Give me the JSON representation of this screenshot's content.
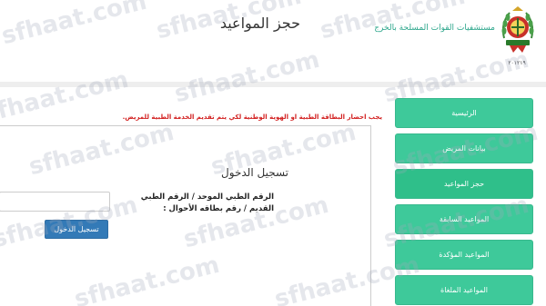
{
  "header": {
    "hospital_name": "مستشفيات القوات المسلحة بالخرج",
    "page_title": "حجز المواعيد",
    "logo_date": "٢٠١٢١٩"
  },
  "warning": "يجب احضار البطاقة الطبية او الهوية الوطنية لكي يتم تقديم الخدمة الطبية للمريض.",
  "sidebar": {
    "items": [
      {
        "label": "الرئيسية"
      },
      {
        "label": "بيانات المريض"
      },
      {
        "label": "حجز المواعيد"
      },
      {
        "label": "المواعيد السابقة"
      },
      {
        "label": "المواعيد المؤكدة"
      },
      {
        "label": "المواعيد الملغاة"
      }
    ]
  },
  "login": {
    "title": "تسجيل الدخول",
    "field_label": "الرقم الطبي الموحد / الرقم الطبي القديم / رقم بطاقه الأحوال :",
    "field_value": "",
    "button_label": "تسجيل الدخول"
  },
  "watermark": {
    "text": "sfhaat.com"
  },
  "colors": {
    "accent_green": "#3ec99a",
    "hospital_name": "#2aa58a",
    "warning_red": "#d21f1f",
    "login_button": "#337ab7"
  }
}
